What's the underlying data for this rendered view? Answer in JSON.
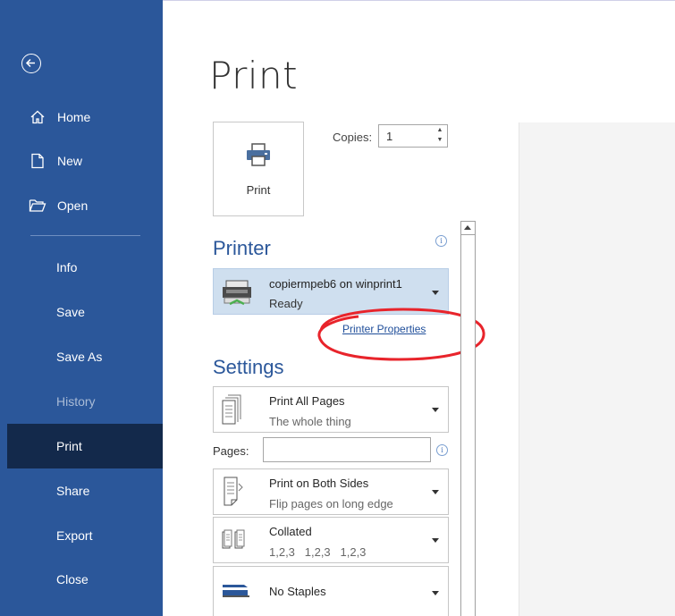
{
  "sidebar": {
    "items": [
      {
        "label": "Home",
        "icon": "home-icon"
      },
      {
        "label": "New",
        "icon": "new-document-icon"
      },
      {
        "label": "Open",
        "icon": "folder-open-icon"
      },
      {
        "label": "Info"
      },
      {
        "label": "Save"
      },
      {
        "label": "Save As"
      },
      {
        "label": "History",
        "disabled": true
      },
      {
        "label": "Print",
        "active": true
      },
      {
        "label": "Share"
      },
      {
        "label": "Export"
      },
      {
        "label": "Close"
      }
    ]
  },
  "main": {
    "title": "Print",
    "print_button_label": "Print",
    "copies": {
      "label": "Copies:",
      "value": "1"
    },
    "printer": {
      "section_title": "Printer",
      "name": "copiermpeb6 on winprint1",
      "status": "Ready",
      "properties_link": "Printer Properties"
    },
    "settings": {
      "section_title": "Settings",
      "print_range": {
        "title": "Print All Pages",
        "subtitle": "The whole thing"
      },
      "pages_label": "Pages:",
      "pages_value": "",
      "sides": {
        "title": "Print on Both Sides",
        "subtitle": "Flip pages on long edge"
      },
      "collation": {
        "title": "Collated",
        "subtitle": "1,2,3   1,2,3   1,2,3"
      },
      "staples": {
        "title": "No Staples"
      }
    }
  },
  "colors": {
    "sidebar_bg": "#2b579a",
    "sidebar_active": "#13294b",
    "accent": "#2b579a",
    "printer_select_bg": "#cfdfef",
    "annotation": "#e8242b"
  }
}
